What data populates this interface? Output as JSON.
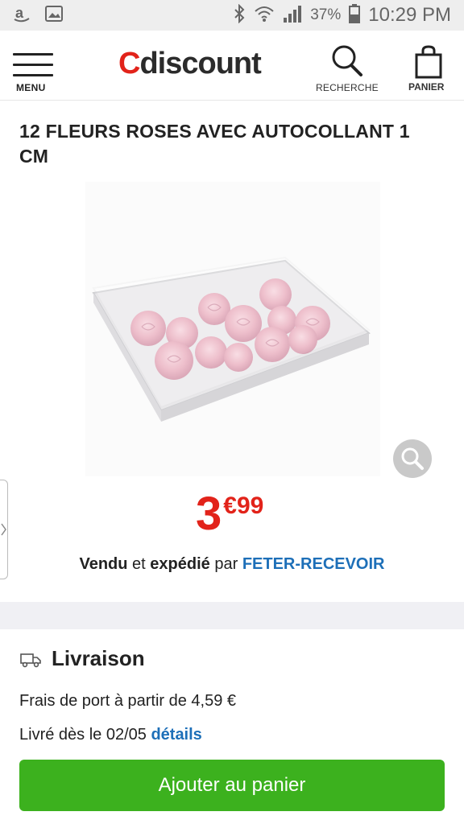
{
  "status_bar": {
    "time": "10:29 PM",
    "battery": "37%",
    "icons": [
      "amazon-icon",
      "image-icon",
      "bluetooth-icon",
      "wifi-icon",
      "signal-icon",
      "battery-icon"
    ]
  },
  "header": {
    "logo_c": "C",
    "logo_rest": "discount",
    "menu_label": "MENU",
    "search_label": "RECHERCHE",
    "cart_label": "PANIER"
  },
  "product": {
    "title": "12 FLEURS ROSES AVEC AUTOCOLLANT 1 CM",
    "price_int": "3",
    "price_cents": "€99",
    "seller_prefix_1": "Vendu",
    "seller_mid_1": " et ",
    "seller_prefix_2": "expédié",
    "seller_mid_2": " par ",
    "seller_name": "FETER-RECEVOIR"
  },
  "delivery": {
    "title": "Livraison",
    "shipping_cost": "Frais de port à partir de 4,59 €",
    "delivery_prefix": "Livré dès le 02/05 ",
    "details_link": "détails"
  },
  "actions": {
    "add_to_cart": "Ajouter au panier"
  },
  "colors": {
    "brand_red": "#e2231a",
    "link_blue": "#1d6fb8",
    "cta_green": "#3cb11e"
  }
}
